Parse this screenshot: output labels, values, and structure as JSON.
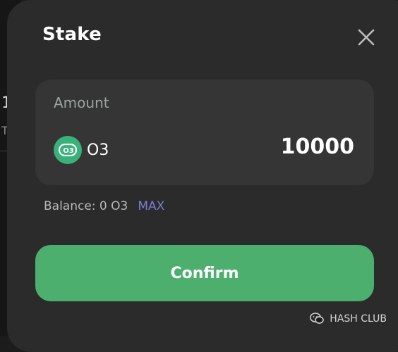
{
  "background": {
    "fragment_1": "1",
    "fragment_2": "T"
  },
  "modal": {
    "title": "Stake",
    "close_icon": "close-icon"
  },
  "amount": {
    "label": "Amount",
    "token_symbol": "O3",
    "token_logo_text": "O3",
    "value": "10000"
  },
  "balance": {
    "label": "Balance: 0 O3",
    "max_label": "MAX"
  },
  "actions": {
    "confirm_label": "Confirm"
  },
  "watermark": {
    "text": "HASH CLUB",
    "icon": "wechat-icon"
  },
  "colors": {
    "modal_bg": "#2b2b2b",
    "card_bg": "#353535",
    "confirm_green": "#4caf6e",
    "token_green": "#3ab07a",
    "max_link": "#7b7bd6"
  }
}
